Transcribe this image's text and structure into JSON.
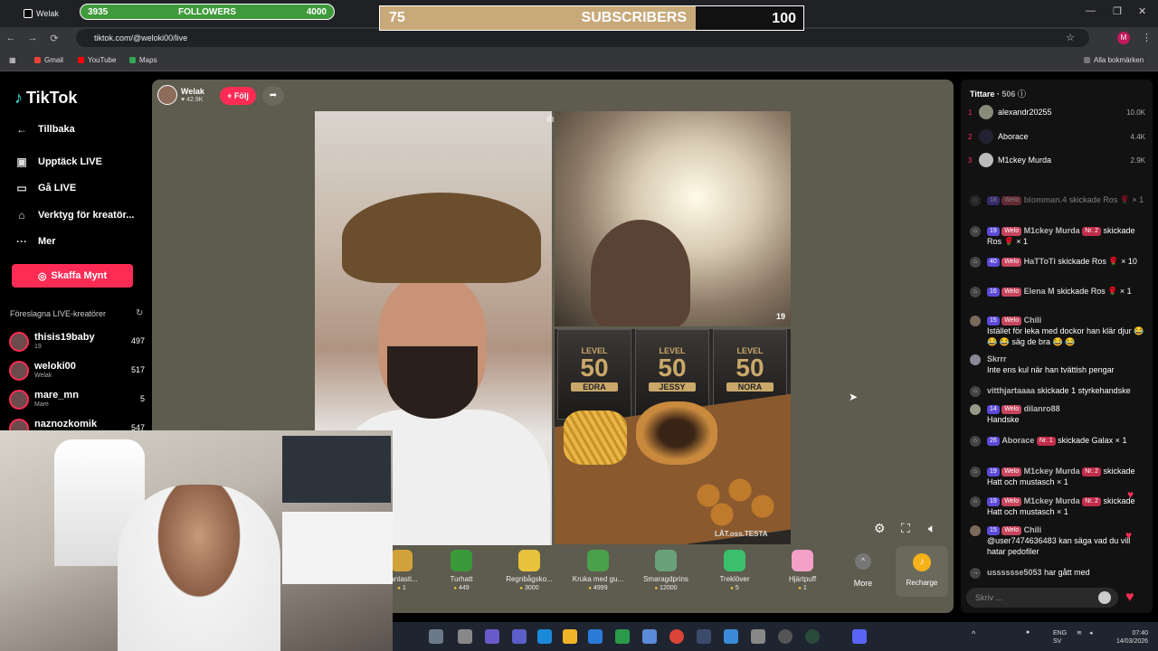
{
  "browser": {
    "tab_title": "Welak",
    "url": "tiktok.com/@weloki00/live",
    "bookmarks": [
      "Gmail",
      "YouTube",
      "Maps"
    ],
    "all_bookmarks": "Alla bokmärken",
    "profile_initial": "M"
  },
  "overlay": {
    "followers": {
      "current": "3935",
      "label": "FOLLOWERS",
      "goal": "4000",
      "progress": 0.98
    },
    "subscribers": {
      "current": "75",
      "label": "SUBSCRIBERS",
      "goal": "100",
      "progress": 0.75
    }
  },
  "sidebar": {
    "logo": "TikTok",
    "back": "Tillbaka",
    "items": [
      {
        "label": "Upptäck LIVE",
        "icon": "live-calendar-icon"
      },
      {
        "label": "Gå LIVE",
        "icon": "camera-icon"
      },
      {
        "label": "Verktyg för kreatör...",
        "icon": "creator-tools-icon"
      },
      {
        "label": "Mer",
        "icon": "more-dots-icon"
      }
    ],
    "coins_button": "Skaffa Mynt",
    "suggested_title": "Föreslagna LIVE-kreatörer",
    "creators": [
      {
        "name": "thisis19baby",
        "sub": "19",
        "count": "497"
      },
      {
        "name": "weloki00",
        "sub": "Welak",
        "count": "517"
      },
      {
        "name": "mare_mn",
        "sub": "Mare",
        "count": "5"
      },
      {
        "name": "naznozkomik",
        "sub": "",
        "count": "547"
      }
    ]
  },
  "stream": {
    "host_name": "Welak",
    "host_likes": "42.9K",
    "follow_label": "+ Följ",
    "guest_number": "19",
    "cards": [
      {
        "level_label": "LEVEL",
        "level": "50",
        "tag": "EDRA"
      },
      {
        "level_label": "LEVEL",
        "level": "50",
        "tag": "JESSY"
      },
      {
        "level_label": "LEVEL",
        "level": "50",
        "tag": "NORA"
      }
    ],
    "watermark": "LÅT.oss.TESTA"
  },
  "gifts": [
    {
      "name": "Fantasti...",
      "price": "1",
      "color": "#d2a23a"
    },
    {
      "name": "Turhatt",
      "price": "449",
      "color": "#3a9a3a"
    },
    {
      "name": "Regnbågsko...",
      "price": "3000",
      "color": "#e8c23a"
    },
    {
      "name": "Kruka med gu...",
      "price": "4999",
      "color": "#4aa04a"
    },
    {
      "name": "Smaragdprins",
      "price": "12000",
      "color": "#6aa07a"
    },
    {
      "name": "Treklöver",
      "price": "5",
      "color": "#3ac06a"
    },
    {
      "name": "Hjärtpuff",
      "price": "1",
      "color": "#f2a0c8"
    }
  ],
  "gift_more": "More",
  "recharge": "Recharge",
  "chat": {
    "viewers_label": "Tittare",
    "viewers_count": "506",
    "top_viewers": [
      {
        "rank": "1",
        "name": "alexandr20255",
        "score": "10.0K"
      },
      {
        "rank": "2",
        "name": "Aborace",
        "score": "4.4K"
      },
      {
        "rank": "3",
        "name": "M1ckey Murda",
        "score": "2.9K"
      }
    ],
    "messages": [
      {
        "level": "18",
        "fan": "Welo",
        "nr": "",
        "user": "blomman.4",
        "text": "skickade Ros 🌹 × 1"
      },
      {
        "level": "19",
        "fan": "Welo",
        "nr": "Nr. 2",
        "user": "M1ckey Murda",
        "text": "skickade Ros 🌹 × 1"
      },
      {
        "level": "40",
        "fan": "Welo",
        "nr": "",
        "user": "HaTToTi",
        "text": "skickade Ros 🌹 × 10"
      },
      {
        "level": "16",
        "fan": "Welo",
        "nr": "",
        "user": "Elena M",
        "text": "skickade Ros 🌹 × 1"
      },
      {
        "level": "15",
        "fan": "Welo",
        "nr": "",
        "user": "Chili",
        "text": "Istället för leka med dockor han klär djur 😂 😂 😂 säg de bra 😂 😂"
      },
      {
        "level": "",
        "fan": "",
        "nr": "",
        "user": "Skrrr",
        "text": "Inte ens kul när han tvättish pengar"
      },
      {
        "level": "",
        "fan": "",
        "nr": "",
        "user": "vitthjartaaaa",
        "text": "skickade 1 styrkehandske"
      },
      {
        "level": "14",
        "fan": "Welo",
        "nr": "",
        "user": "dilanro88",
        "text": "Handske"
      },
      {
        "level": "26",
        "fan": "",
        "nr": "Nr. 1",
        "user": "Aborace",
        "text": "skickade Galax × 1"
      },
      {
        "level": "19",
        "fan": "Welo",
        "nr": "Nr. 2",
        "user": "M1ckey Murda",
        "text": "skickade Hatt och mustasch × 1"
      },
      {
        "level": "19",
        "fan": "Welo",
        "nr": "Nr. 2",
        "user": "M1ckey Murda",
        "text": "skickade Hatt och mustasch × 1"
      },
      {
        "level": "15",
        "fan": "Welo",
        "nr": "",
        "user": "Chili",
        "text": "@user7474636483 kan säga vad du vill hatar pedofiler"
      },
      {
        "level": "",
        "fan": "",
        "nr": "",
        "user": "usssssse5053",
        "text": "har gått med"
      }
    ],
    "input_placeholder": "Skriv ..."
  },
  "taskbar": {
    "lang": "ENG",
    "region": "SV",
    "time": "07:40",
    "date": "14/03/2026"
  }
}
